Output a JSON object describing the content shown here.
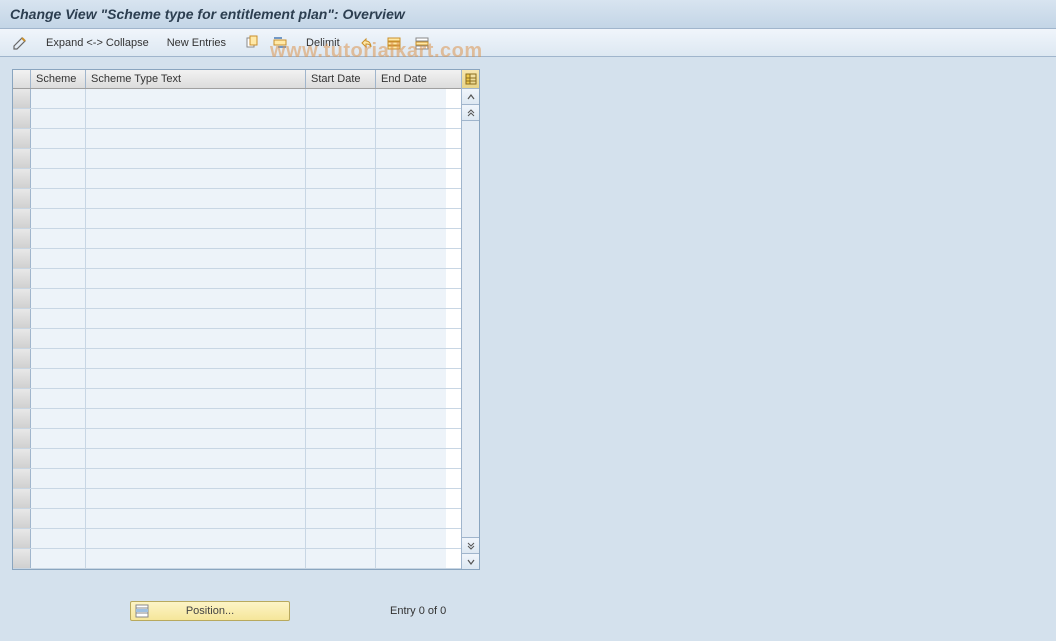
{
  "page_title": "Change View \"Scheme type for entitlement plan\": Overview",
  "toolbar": {
    "expand_collapse_label": "Expand <-> Collapse",
    "new_entries_label": "New Entries",
    "delimit_label": "Delimit"
  },
  "table": {
    "columns": {
      "scheme": "Scheme",
      "scheme_type_text": "Scheme Type Text",
      "start_date": "Start Date",
      "end_date": "End Date"
    },
    "row_count": 24
  },
  "footer": {
    "position_label": "Position...",
    "entry_status": "Entry 0 of 0"
  },
  "watermark": "www.tutorialkart.com",
  "icons": {
    "pencil": "pencil-icon",
    "copy": "copy-icon",
    "delete": "delete-icon",
    "undo": "undo-icon",
    "select_all": "select-all-icon",
    "deselect_all": "deselect-all-icon",
    "config": "table-settings-icon"
  }
}
